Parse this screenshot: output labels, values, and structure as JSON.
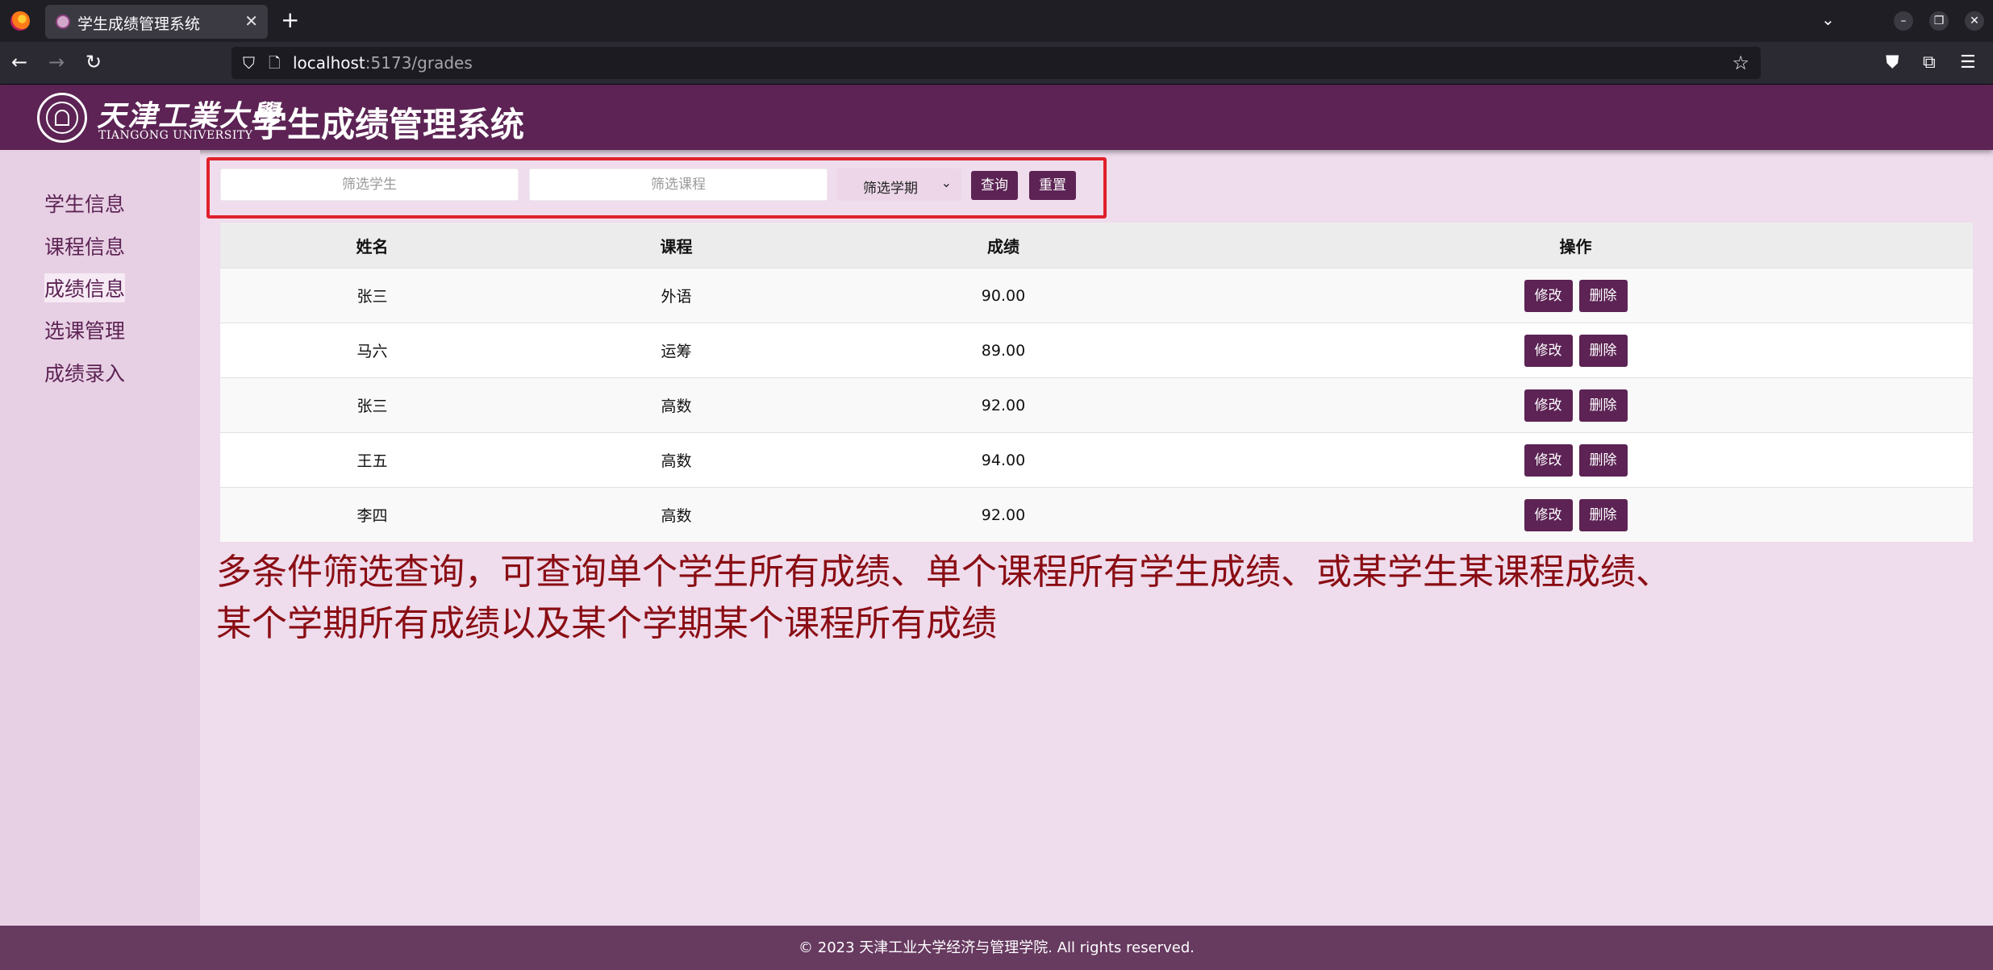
{
  "browser": {
    "tab_title": "学生成绩管理系统",
    "tab_close": "✕",
    "new_tab": "+",
    "url_host": "localhost",
    "url_path": ":5173/grades"
  },
  "header": {
    "logo_cn": "天津工業大學",
    "logo_en": "TIANGONG UNIVERSITY",
    "title": "学生成绩管理系统"
  },
  "sidebar": {
    "items": [
      {
        "label": "学生信息"
      },
      {
        "label": "课程信息"
      },
      {
        "label": "成绩信息"
      },
      {
        "label": "选课管理"
      },
      {
        "label": "成绩录入"
      }
    ],
    "active_index": 2
  },
  "filters": {
    "student_placeholder": "筛选学生",
    "course_placeholder": "筛选课程",
    "term_selected": "筛选学期",
    "query_label": "查询",
    "reset_label": "重置"
  },
  "table": {
    "headers": [
      "姓名",
      "课程",
      "成绩",
      "操作"
    ],
    "edit_label": "修改",
    "delete_label": "删除",
    "rows": [
      {
        "name": "张三",
        "course": "外语",
        "score": "90.00"
      },
      {
        "name": "马六",
        "course": "运筹",
        "score": "89.00"
      },
      {
        "name": "张三",
        "course": "高数",
        "score": "92.00"
      },
      {
        "name": "王五",
        "course": "高数",
        "score": "94.00"
      },
      {
        "name": "李四",
        "course": "高数",
        "score": "92.00"
      }
    ]
  },
  "annotation": {
    "line1": "多条件筛选查询，可查询单个学生所有成绩、单个课程所有学生成绩、或某学生某课程成绩、",
    "line2": "某个学期所有成绩以及某个学期某个课程所有成绩"
  },
  "footer": {
    "text": "© 2023 天津工业大学经济与管理学院. All rights reserved."
  }
}
